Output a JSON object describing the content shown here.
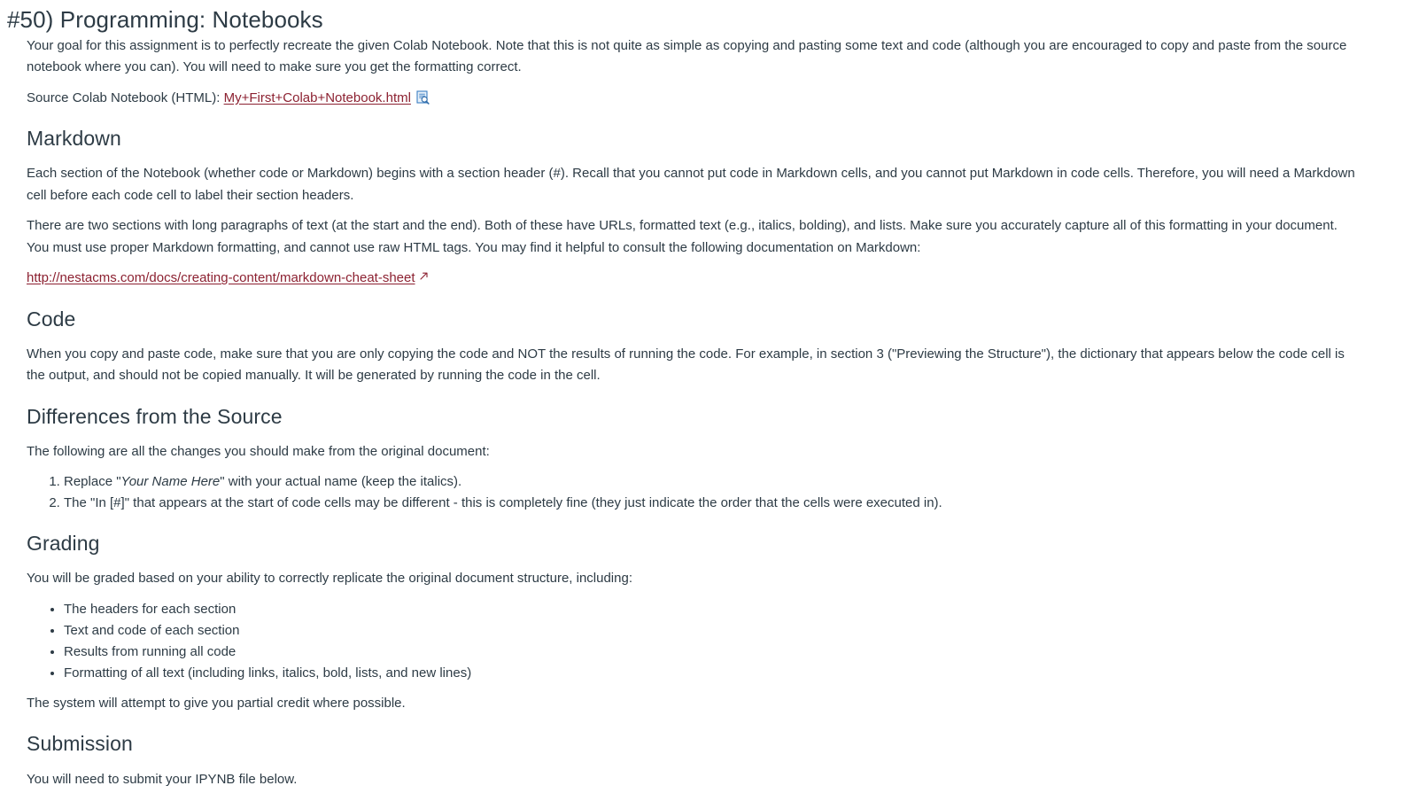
{
  "page": {
    "title": "#50) Programming: Notebooks"
  },
  "intro": {
    "paragraph": "Your goal for this assignment is to perfectly recreate the given Colab Notebook. Note that this is not quite as simple as copying and pasting some text and code (although you are encouraged to copy and paste from the source notebook where you can). You will need to make sure you get the formatting correct.",
    "source_label": "Source Colab Notebook (HTML): ",
    "source_link_text": "My+First+Colab+Notebook.html",
    "source_icon": "document-preview-icon"
  },
  "markdown_section": {
    "heading": "Markdown",
    "paragraph_1": "Each section of the Notebook (whether code or Markdown) begins with a section header (#). Recall that you cannot put code in Markdown cells, and you cannot put Markdown in code cells. Therefore, you will need a Markdown cell before each code cell to label their section headers.",
    "paragraph_2": "There are two sections with long paragraphs of text (at the start and the end). Both of these have URLs, formatted text (e.g., italics, bolding), and lists. Make sure you accurately capture all of this formatting in your document. You must use proper Markdown formatting, and cannot use raw HTML tags. You may find it helpful to consult the following documentation on Markdown:",
    "cheat_sheet_link": "http://nestacms.com/docs/creating-content/markdown-cheat-sheet",
    "external_icon": "external-link-icon"
  },
  "code_section": {
    "heading": "Code",
    "paragraph": "When you copy and paste code, make sure that you are only copying the code and NOT the results of running the code. For example, in section 3 (\"Previewing the Structure\"), the dictionary that appears below the code cell is the output, and should not be copied manually. It will be generated by running the code in the cell."
  },
  "differences_section": {
    "heading": "Differences from the Source",
    "intro": "The following are all the changes you should make from the original document:",
    "items": [
      {
        "before": "Replace \"",
        "italic": "Your Name Here",
        "after": "\" with your actual name (keep the italics)."
      },
      {
        "before": "The \"In [#]\" that appears at the start of code cells may be different - this is completely fine (they just indicate the order that the cells were executed in).",
        "italic": "",
        "after": ""
      }
    ]
  },
  "grading_section": {
    "heading": "Grading",
    "intro": "You will be graded based on your ability to correctly replicate the original document structure, including:",
    "items": [
      "The headers for each section",
      "Text and code of each section",
      "Results from running all code",
      "Formatting of all text (including links, italics, bold, lists, and new lines)"
    ],
    "closing": "The system will attempt to give you partial credit where possible."
  },
  "submission_section": {
    "heading": "Submission",
    "paragraph": "You will need to submit your IPYNB file below."
  },
  "colors": {
    "text": "#2d3b45",
    "link": "#8c2131",
    "icon_blue": "#3b7fc4",
    "background": "#ffffff"
  }
}
